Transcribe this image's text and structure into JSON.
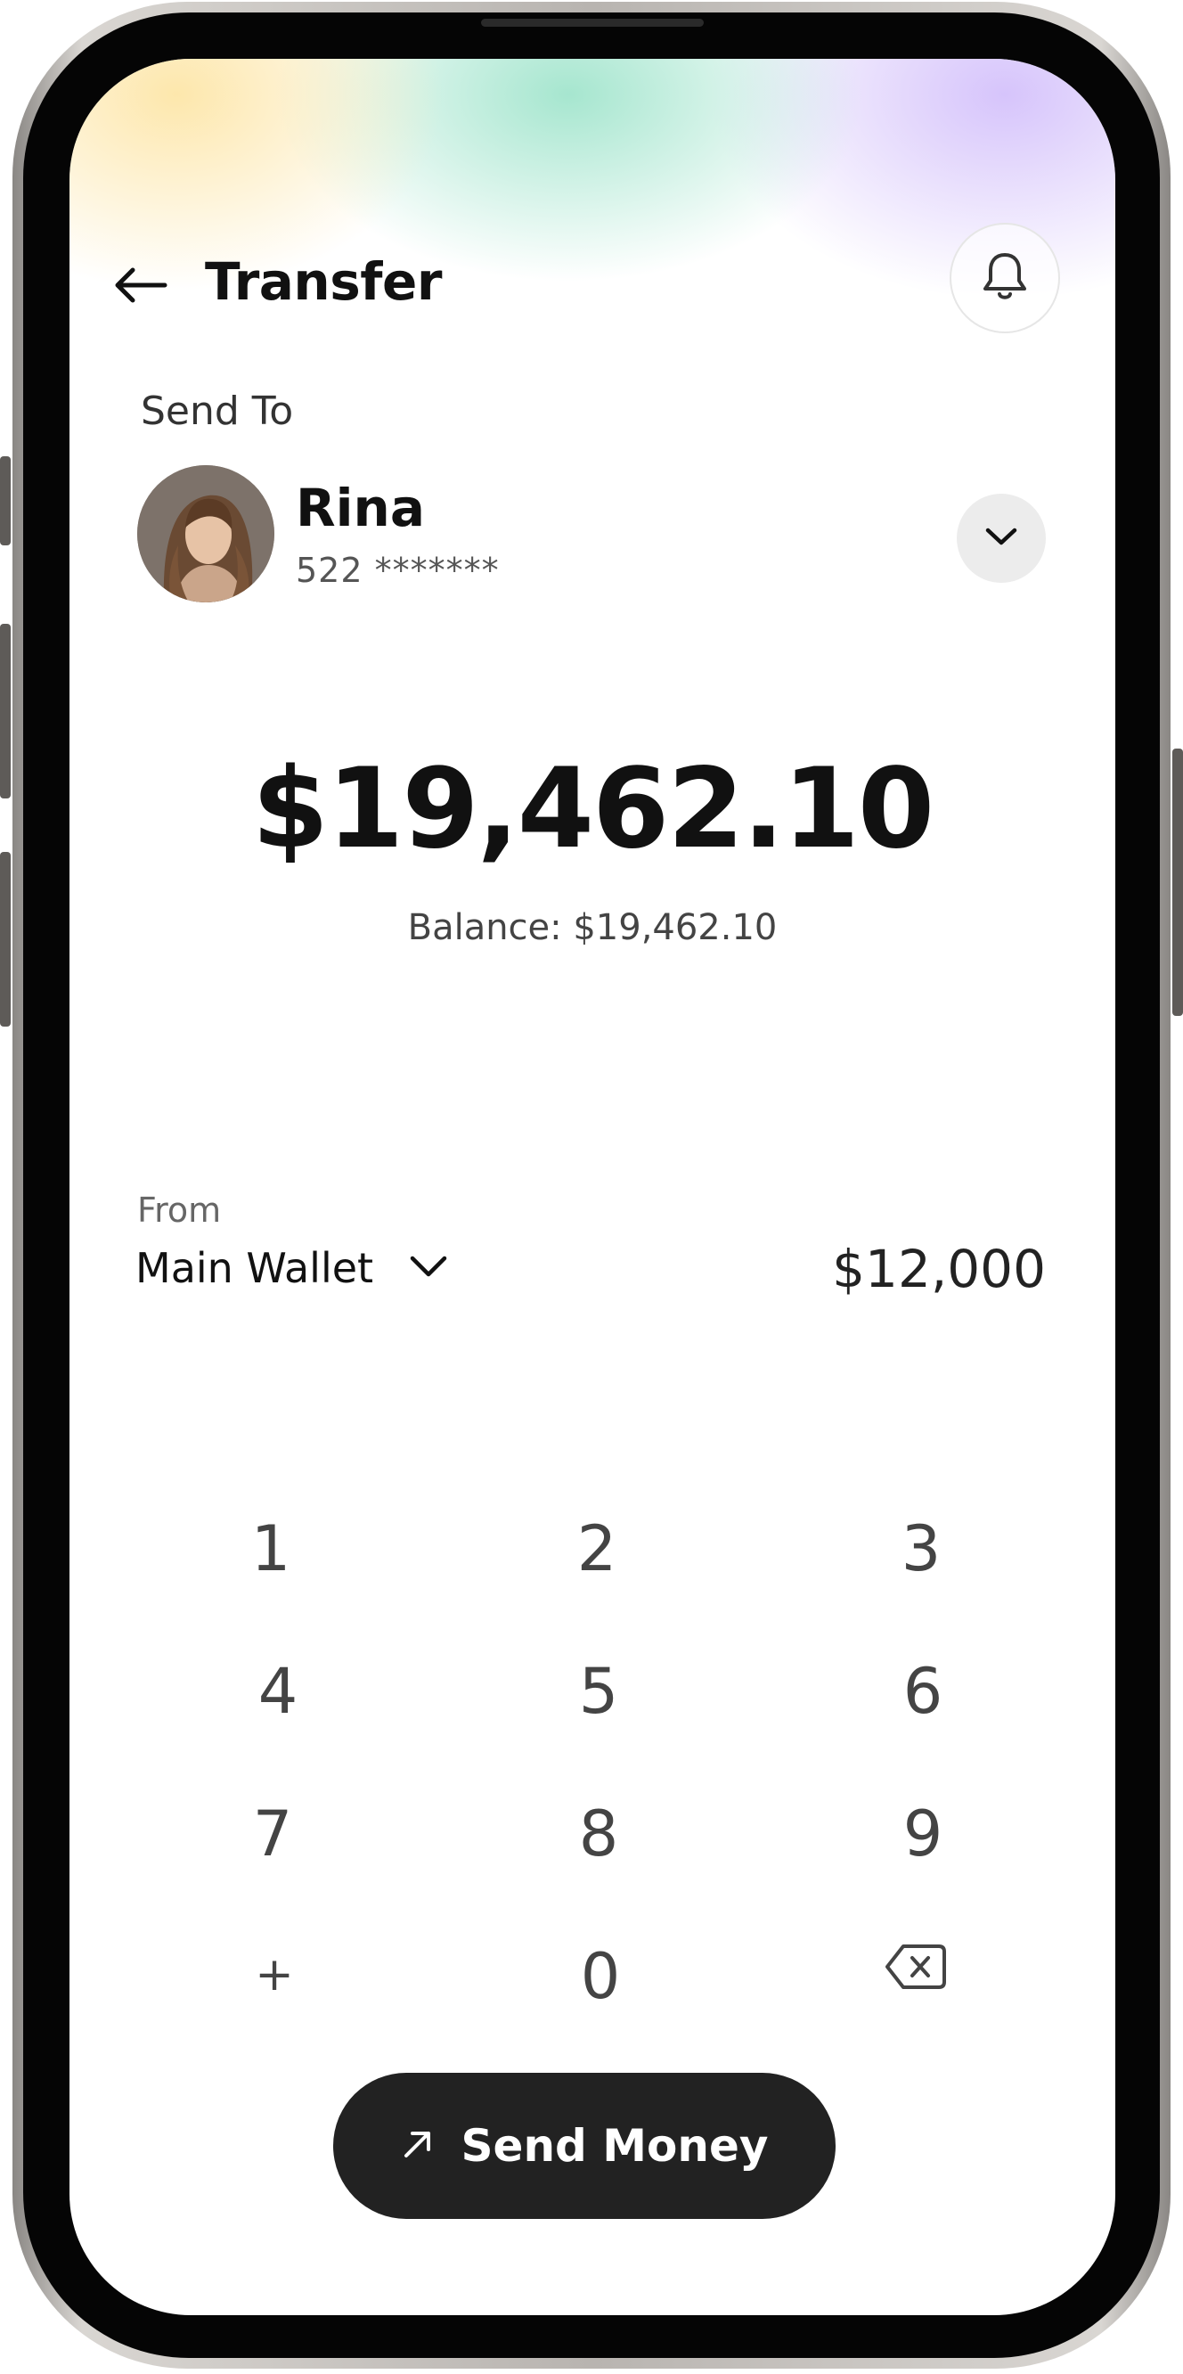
{
  "header": {
    "title": "Transfer",
    "back_icon": "arrow-left-icon",
    "notification_icon": "bell-icon"
  },
  "send_to": {
    "label": "Send To",
    "recipient": {
      "name": "Rina",
      "account": "522 *******"
    },
    "expand_icon": "chevron-down-icon"
  },
  "amount": {
    "value": "$19,462.10",
    "balance": "Balance: $19,462.10"
  },
  "from": {
    "label": "From",
    "wallet": "Main Wallet",
    "wallet_amount": "$12,000",
    "dropdown_icon": "chevron-down-icon"
  },
  "keypad": {
    "keys": [
      "1",
      "2",
      "3",
      "4",
      "5",
      "6",
      "7",
      "8",
      "9",
      "+",
      "0"
    ],
    "delete_icon": "backspace-icon"
  },
  "action": {
    "label": "Send Money",
    "icon": "arrow-up-right-icon"
  },
  "colors": {
    "primary_dark": "#222222",
    "text": "#111111",
    "glow_yellow": "#fde7ac",
    "glow_green": "#a6e6cf",
    "glow_purple": "#d6c4fb"
  }
}
